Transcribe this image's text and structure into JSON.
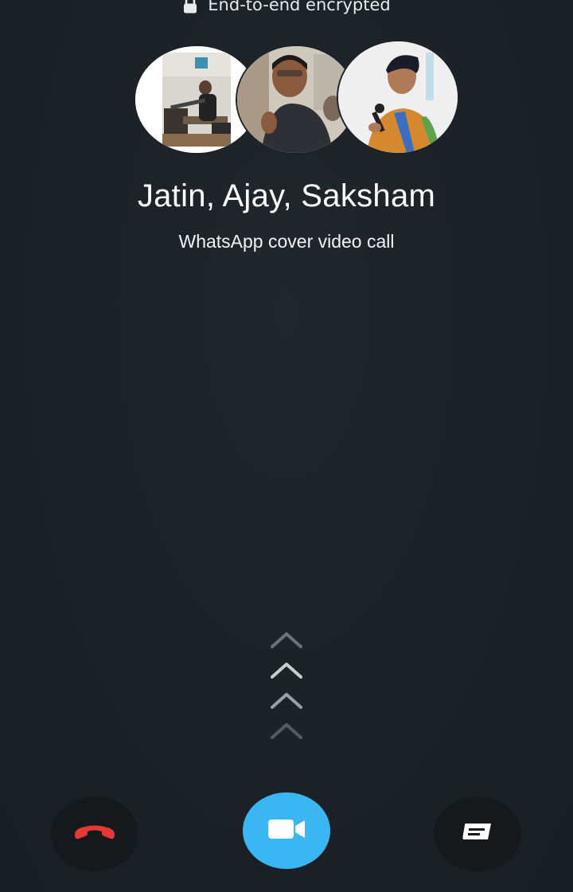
{
  "header": {
    "encrypted_text": "End-to-end encrypted",
    "lock_icon": "lock-icon"
  },
  "call": {
    "participants": [
      "Jatin",
      "Ajay",
      "Saksham"
    ],
    "name_line": "Jatin, Ajay, Saksham",
    "subtitle": "WhatsApp cover video call"
  },
  "avatars": [
    {
      "name": "Jatin",
      "icon": "avatar-photo"
    },
    {
      "name": "Ajay",
      "icon": "avatar-photo"
    },
    {
      "name": "Saksham",
      "icon": "avatar-photo"
    }
  ],
  "controls": {
    "decline_icon": "phone-hangup-icon",
    "accept_icon": "video-camera-icon",
    "message_icon": "message-icon",
    "swipe_hint_icon": "chevrons-up-icon"
  },
  "colors": {
    "background": "#1c2227",
    "accept": "#3ab6f3",
    "decline": "#e53935",
    "button_dark": "#15191c"
  }
}
